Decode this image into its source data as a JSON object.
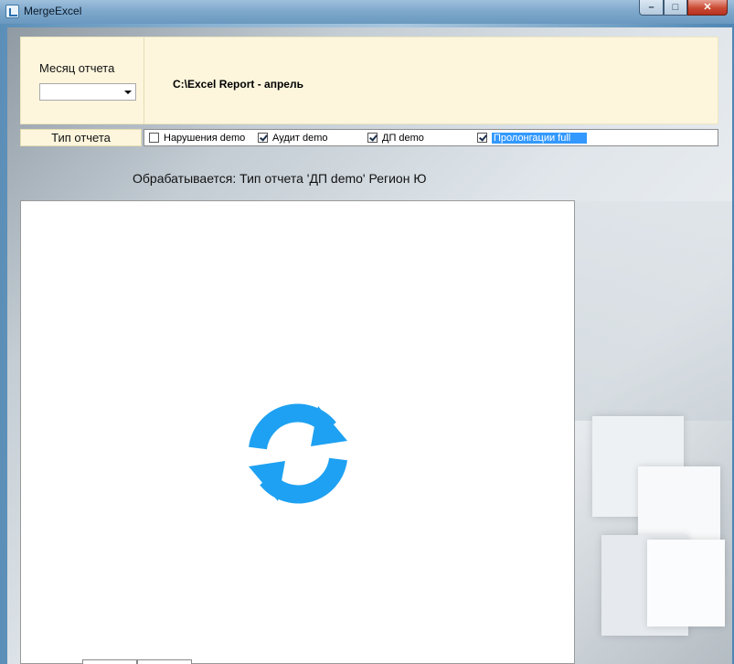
{
  "window": {
    "title": "MergeExcel",
    "controls": {
      "minimize": "–",
      "maximize": "□",
      "close": "✕"
    }
  },
  "top_panel": {
    "month_label": "Месяц отчета",
    "month_value": "",
    "path_text": "C:\\Excel Report - апрель"
  },
  "report_types": {
    "label": "Тип отчета",
    "items": [
      {
        "label": "Нарушения demo",
        "checked": false,
        "selected": false
      },
      {
        "label": "Аудит demo",
        "checked": true,
        "selected": false
      },
      {
        "label": "ДП demo",
        "checked": true,
        "selected": false
      },
      {
        "label": "Пролонгации full",
        "checked": true,
        "selected": true
      }
    ]
  },
  "status_text": "Обрабатывается: Тип отчета 'ДП demo' Регион Ю",
  "icons": {
    "app": "app-icon",
    "dropdown": "chevron-down-icon",
    "loading": "refresh-icon"
  },
  "colors": {
    "accent": "#1ea1f2",
    "selection": "#3399ff",
    "panel_bg": "#fdf6dd"
  }
}
